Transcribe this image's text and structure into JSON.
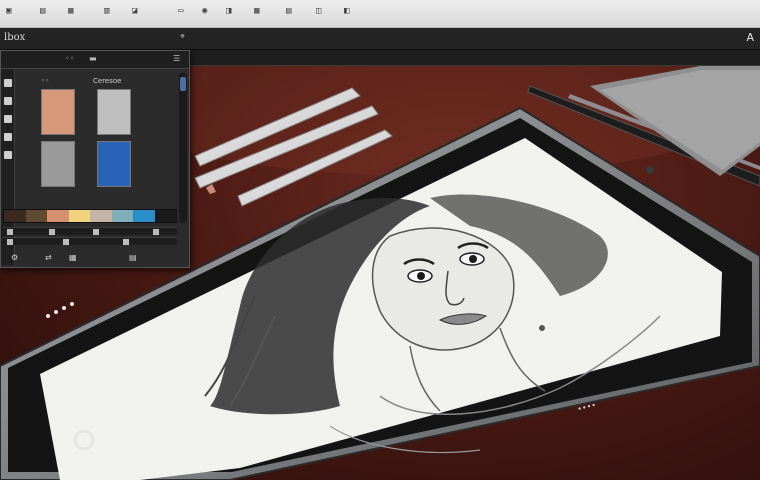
{
  "window": {
    "app_label": "lbox",
    "right_label": "A"
  },
  "panel": {
    "tab_label_2": "Ceresoe",
    "swatches": [
      {
        "color": "#d69a7a"
      },
      {
        "color": "#bfbfbf"
      },
      {
        "color": "#9a9a9a"
      },
      {
        "color": "#2a63b8"
      }
    ],
    "palette": [
      "#3c2a22",
      "#5f4a33",
      "#d49070",
      "#f2d27a",
      "#c4b4a8",
      "#7fb0b8",
      "#2a8fc6",
      "#1a1a1a"
    ]
  },
  "tablet": {
    "body_color": "#7d7f82",
    "screen_color": "#f1f1ee",
    "port_label": "••••"
  },
  "colors": {
    "desk": "#5a1f17",
    "panel_bg": "#2b2b2b",
    "accent_blue": "#4a6fa0"
  },
  "icons": [
    "folder-icon",
    "save-icon",
    "grid-icon",
    "layers-icon",
    "brush-icon",
    "eraser-icon",
    "eye-icon",
    "text-icon",
    "pin-icon"
  ]
}
